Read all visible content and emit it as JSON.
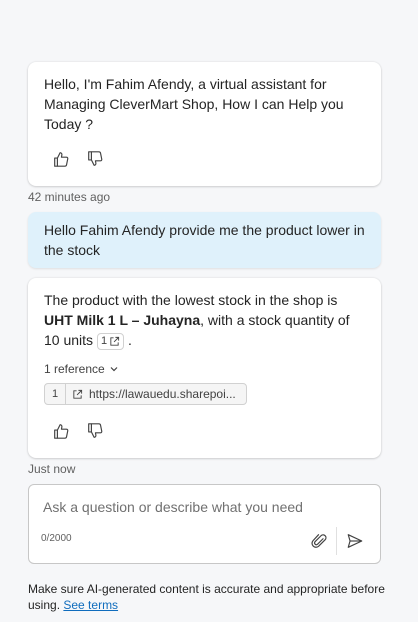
{
  "messages": {
    "greeting": "Hello, I'm Fahim Afendy, a virtual assistant for Managing CleverMart Shop, How I can Help you Today ?",
    "greeting_time": "42 minutes ago",
    "user_message": "Hello Fahim Afendy provide me the product lower in the stock",
    "reply_part1": "The product with the lowest stock in the shop is ",
    "reply_bold": "UHT Milk 1 L – Juhayna",
    "reply_part2": ", with a stock quantity of 10 units ",
    "reply_citation": "1",
    "reply_end": ".",
    "reply_time": "Just now",
    "references_label": "1 reference",
    "reference_number": "1",
    "reference_url": "https://lawauedu.sharepoi..."
  },
  "composer": {
    "placeholder": "Ask a question or describe what you need",
    "counter": "0/2000"
  },
  "footer": {
    "disclaimer": "Make sure AI-generated content is accurate and appropriate before using.",
    "terms_link": "See terms"
  },
  "colors": {
    "user_bubble": "#dff1fb",
    "link": "#0f6cbd"
  },
  "icons": [
    "thumbs-up-icon",
    "thumbs-down-icon",
    "external-link-icon",
    "chevron-down-icon",
    "paperclip-icon",
    "send-icon"
  ]
}
